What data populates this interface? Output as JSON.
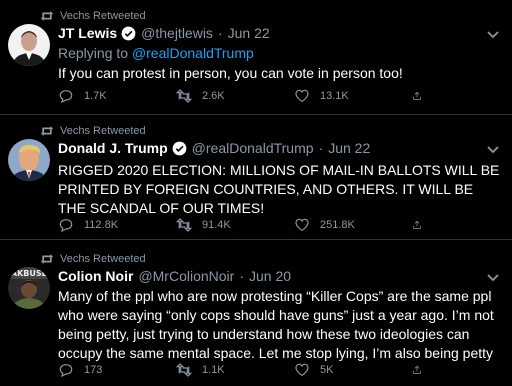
{
  "tweets": [
    {
      "retweeted_by": "Vechs Retweeted",
      "name": "JT Lewis",
      "handle": "@thejtlewis",
      "dot": "·",
      "date": "Jun 22",
      "replying_label": "Replying to",
      "replying_to": "@realDonaldTrump",
      "text": "If you can protest in person, you can vote in person too!",
      "replies": "1.7K",
      "retweets": "2.6K",
      "likes": "13.1K"
    },
    {
      "retweeted_by": "Vechs Retweeted",
      "name": "Donald J. Trump",
      "handle": "@realDonaldTrump",
      "dot": "·",
      "date": "Jun 22",
      "text": "RIGGED 2020 ELECTION: MILLIONS OF MAIL-IN BALLOTS WILL BE PRINTED BY FOREIGN COUNTRIES, AND OTHERS. IT WILL BE THE SCANDAL OF OUR TIMES!",
      "replies": "112.8K",
      "retweets": "91.4K",
      "likes": "251.8K"
    },
    {
      "retweeted_by": "Vechs Retweeted",
      "name": "Colion Noir",
      "handle": "@MrColionNoir",
      "dot": "·",
      "date": "Jun 20",
      "avatar_text": "AKBUSE",
      "text": "Many of the ppl who are now protesting “Killer Cops” are the same ppl who were saying “only cops should have guns” just a year ago. I’m not being petty, just trying to understand how these two ideologies can occupy the same mental space. Let me stop lying, I’m also being petty",
      "replies": "173",
      "retweets": "1.1K",
      "likes": "5K"
    }
  ],
  "colors": {
    "background": "#000000",
    "accent": "#1da1f2",
    "muted": "#8b98a5",
    "divider": "#2f3336"
  }
}
